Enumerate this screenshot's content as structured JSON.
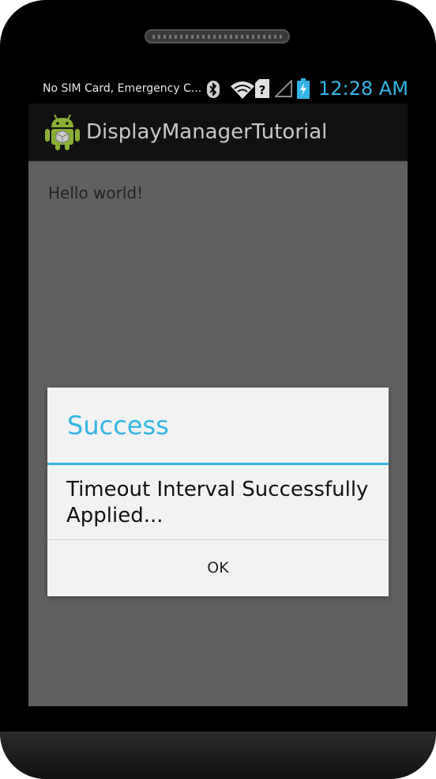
{
  "status_bar": {
    "carrier": "No SIM Card, Emergency C...",
    "time": "12:28 AM",
    "icons": [
      "bluetooth-icon",
      "wifi-icon",
      "no-sim-icon",
      "signal-icon",
      "battery-charging-icon"
    ]
  },
  "action_bar": {
    "app_icon": "android-app-icon",
    "title": "DisplayManagerTutorial"
  },
  "content": {
    "hello_text": "Hello world!"
  },
  "dialog": {
    "title": "Success",
    "message": "Timeout Interval Successfully Applied...",
    "ok_label": "OK"
  },
  "colors": {
    "accent": "#33b5e5",
    "dim_background": "#606060",
    "dialog_background": "#f2f2f2"
  }
}
